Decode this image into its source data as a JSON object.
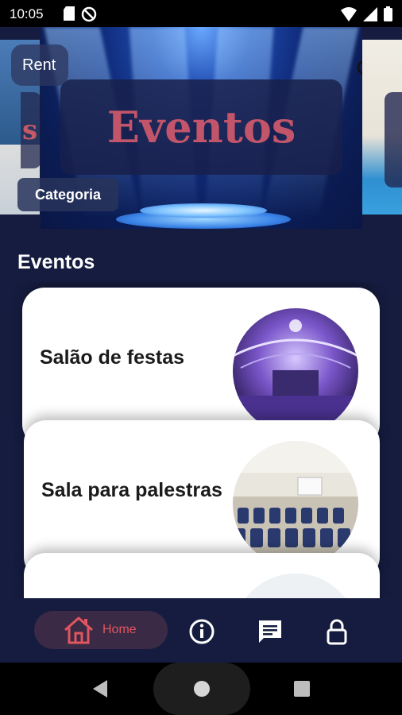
{
  "status_bar": {
    "time": "10:05"
  },
  "carousel": {
    "main_title": "Eventos",
    "left_peek_title": "s",
    "rent_label": "Rent",
    "categoria_label": "Categoria"
  },
  "section": {
    "title": "Eventos"
  },
  "events": [
    {
      "label": "Salão de festas"
    },
    {
      "label": "Sala para palestras"
    },
    {
      "label": ""
    }
  ],
  "bottom_nav": {
    "home_label": "Home",
    "accent_color": "#e0555f"
  },
  "colors": {
    "background": "#161c3f",
    "title_red": "#c3556a"
  }
}
